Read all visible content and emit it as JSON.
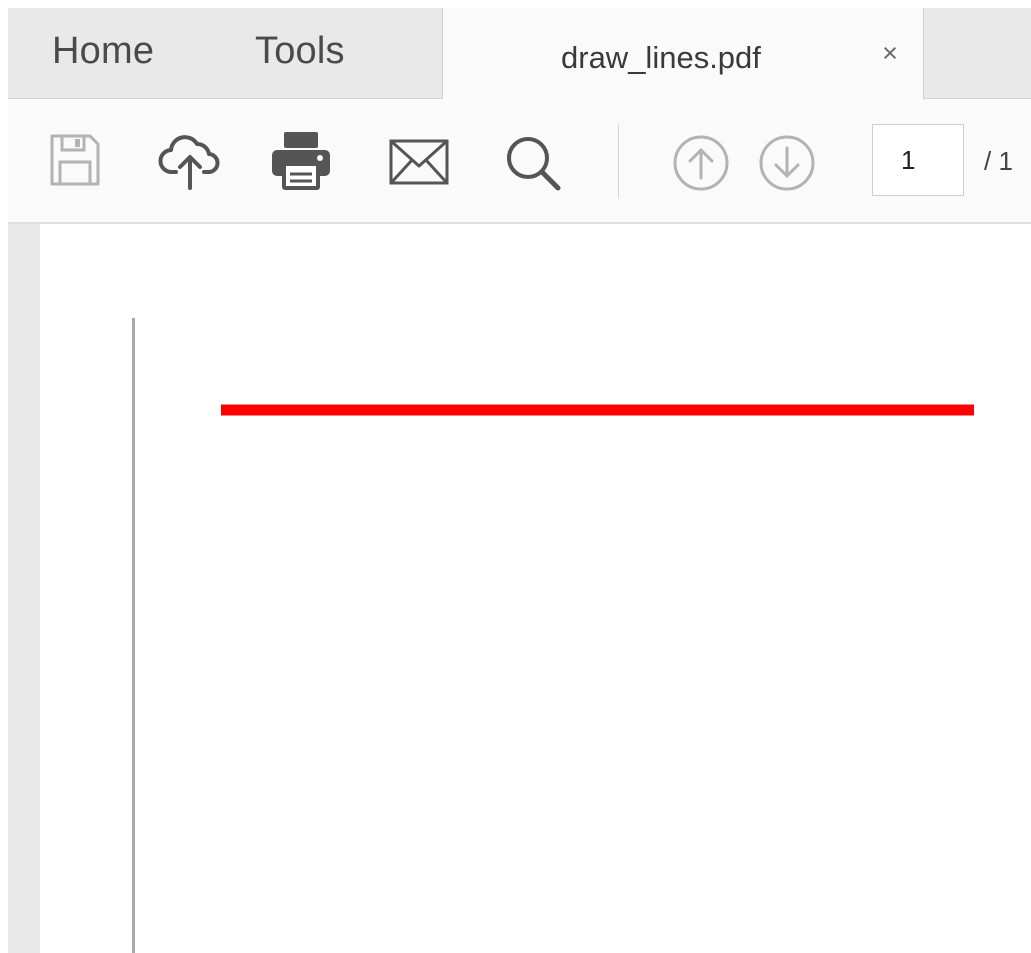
{
  "tabs": {
    "home_label": "Home",
    "tools_label": "Tools",
    "document_title": "draw_lines.pdf",
    "close_glyph": "×"
  },
  "toolbar": {
    "icons": [
      "save-icon",
      "upload-cloud-icon",
      "print-icon",
      "email-icon",
      "search-icon",
      "previous-page-icon",
      "next-page-icon"
    ],
    "page_number": "1",
    "page_total": "/ 1"
  },
  "document": {
    "line_color": "#ff0000",
    "page_edge_color": "#a9a9a9"
  },
  "colors": {
    "tab_bar_bg": "#e9e9e9",
    "active_tab_bg": "#fafafa",
    "icon_active": "#555555",
    "icon_disabled": "#b3b3b3"
  }
}
